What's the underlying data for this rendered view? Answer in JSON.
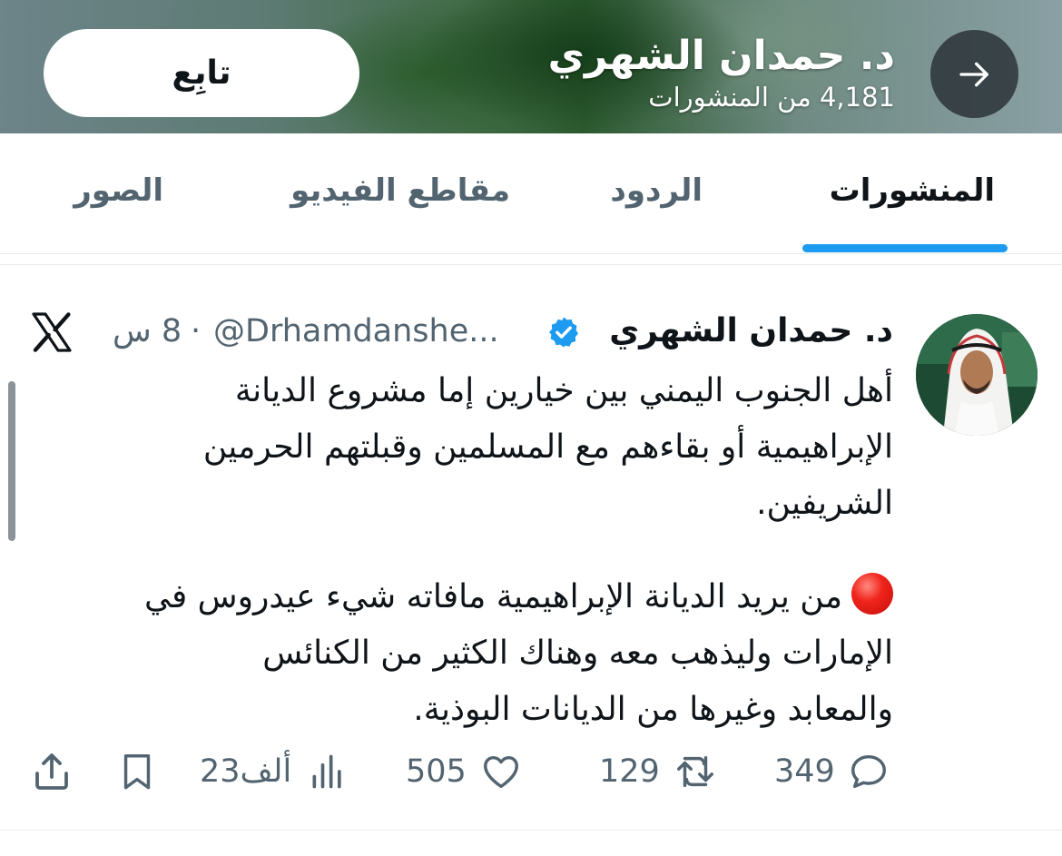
{
  "header": {
    "profile_name": "د. حمدان الشهري",
    "posts_count": "4,181 من المنشورات",
    "follow_label": "تابِع",
    "back_icon": "arrow-right-icon"
  },
  "tabs": [
    {
      "label": "المنشورات",
      "active": true
    },
    {
      "label": "الردود",
      "active": false
    },
    {
      "label": "مقاطع الفيديو",
      "active": false
    },
    {
      "label": "الصور",
      "active": false
    }
  ],
  "tweet": {
    "author_name": "د. حمدان الشهري",
    "handle": "@Drhamdanshe...",
    "separator": "·",
    "time": "8 س",
    "paragraph1_lines": [
      "أهل الجنوب اليمني بين خيارين إما مشروع الديانة",
      "الإبراهيمية أو بقاءهم مع المسلمين وقبلتهم الحرمين",
      "الشريفين."
    ],
    "paragraph2_lines": [
      "من يريد الديانة الإبراهيمية مافاته شيء عيدروس في",
      "الإمارات وليذهب معه وهناك الكثير من الكنائس",
      "والمعابد وغيرها من الديانات البوذية."
    ],
    "replies": "349",
    "reposts": "129",
    "likes": "505",
    "views": "23ألف"
  },
  "colors": {
    "accent": "#1d9bf0",
    "text_primary": "#0f1419",
    "text_secondary": "#536471",
    "red_dot": "#e0241c"
  }
}
